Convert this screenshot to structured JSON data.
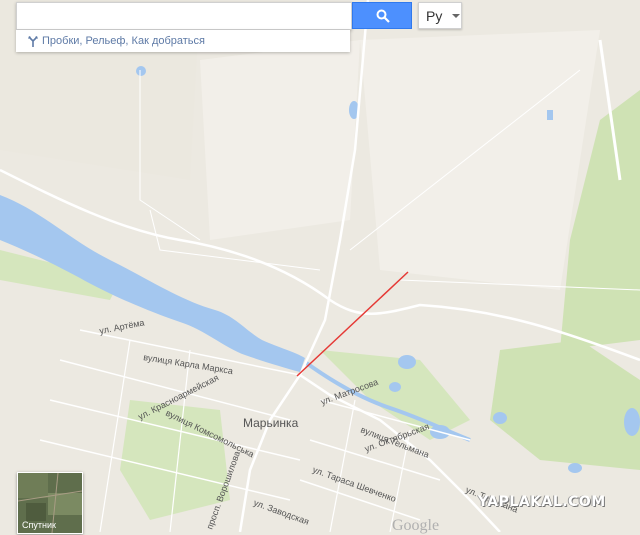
{
  "search": {
    "value": "",
    "suggest_text": "Пробки, Рельеф, Как добраться"
  },
  "language": {
    "label": "Ру"
  },
  "satellite": {
    "label": "Спутник"
  },
  "map": {
    "town": "Марьинка",
    "streets": [
      "ул. Артёма",
      "вулиця Карла Маркса",
      "ул. Красноармейская",
      "вулиця Комсомольська",
      "просп. Ворошилова",
      "ул. Матросова",
      "вулиця Тельмана",
      "ул. Октябрьская",
      "ул. Тараса Шевченко",
      "ул. Заводская",
      "ул. Тельмана"
    ],
    "google_label": "Google",
    "watermark": "YAPLAKAL.COM",
    "colors": {
      "land": "#ece9e1",
      "field": "#f2efe9",
      "water": "#a4c7ef",
      "park": "#cfe2b4",
      "road": "#ffffff",
      "route": "#e53935"
    }
  }
}
